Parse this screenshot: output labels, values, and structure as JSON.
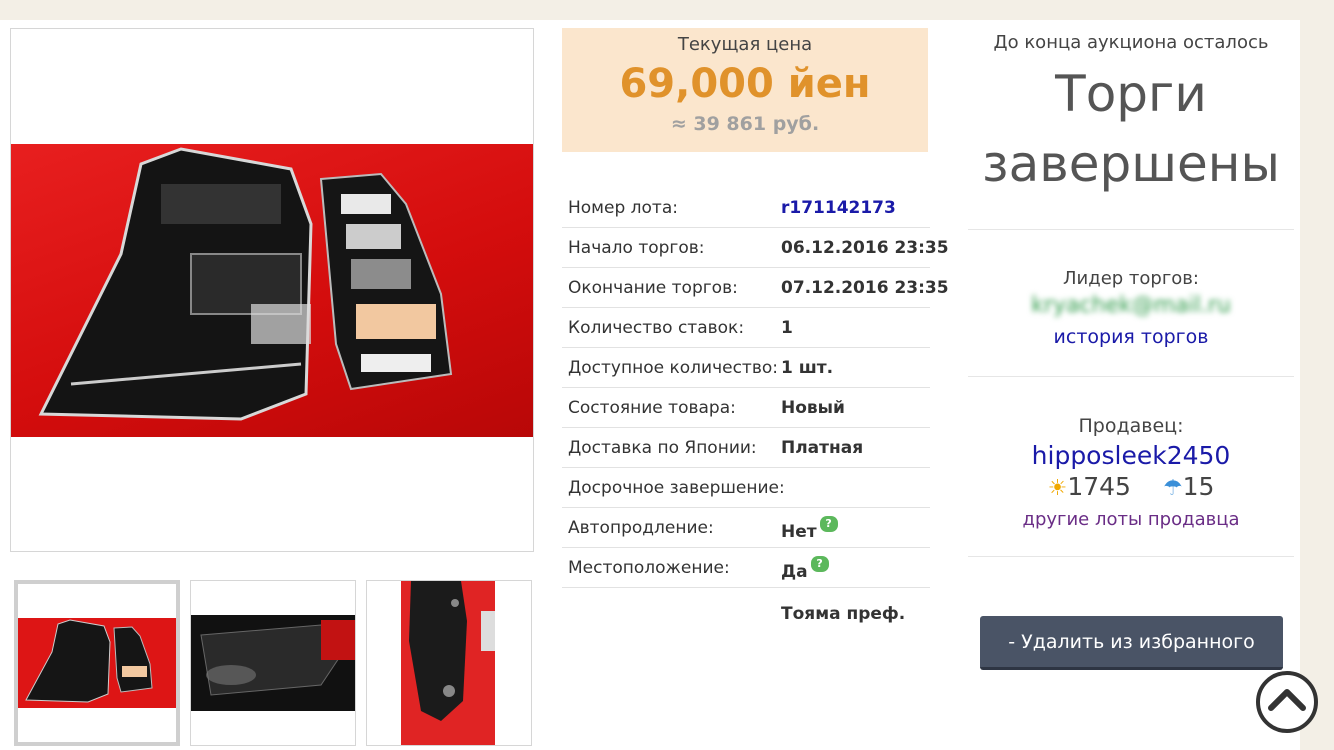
{
  "price": {
    "label": "Текущая цена",
    "value": "69,000 йен",
    "rub": "≈ 39 861 руб."
  },
  "details": [
    {
      "key": "Номер лота:",
      "value": "r171142173",
      "link": true
    },
    {
      "key": "Начало торгов:",
      "value": "06.12.2016 23:35"
    },
    {
      "key": "Окончание торгов:",
      "value": "07.12.2016 23:35"
    },
    {
      "key": "Количество ставок:",
      "value": "1"
    },
    {
      "key": "Доступное количество:",
      "value": "1 шт."
    },
    {
      "key": "Состояние товара:",
      "value": "Новый"
    },
    {
      "key": "Доставка по Японии:",
      "value": "Платная"
    },
    {
      "key": "Досрочное завершение:",
      "value": "Нет"
    },
    {
      "key": "Автопродление:",
      "value": "Да"
    },
    {
      "key": "Местоположение:",
      "value": "Тояма преф."
    }
  ],
  "help_icon": "?",
  "auction": {
    "end_label": "До конца аукциона осталось",
    "status_line1": "Торги",
    "status_line2": "завершены"
  },
  "leader": {
    "label": "Лидер торгов:",
    "name": "kryachek@mail.ru",
    "history_link": "история торгов"
  },
  "seller": {
    "label": "Продавец:",
    "name": "hipposleek2450",
    "positive": "1745",
    "negative": "15",
    "other_lots": "другие лоты продавца"
  },
  "buttons": {
    "remove_favorite": "- Удалить из избранного"
  },
  "colors": {
    "price": "#e0922b",
    "price_bg": "#fbe6cd",
    "link": "#1a1aa8",
    "button": "#4a5466"
  }
}
